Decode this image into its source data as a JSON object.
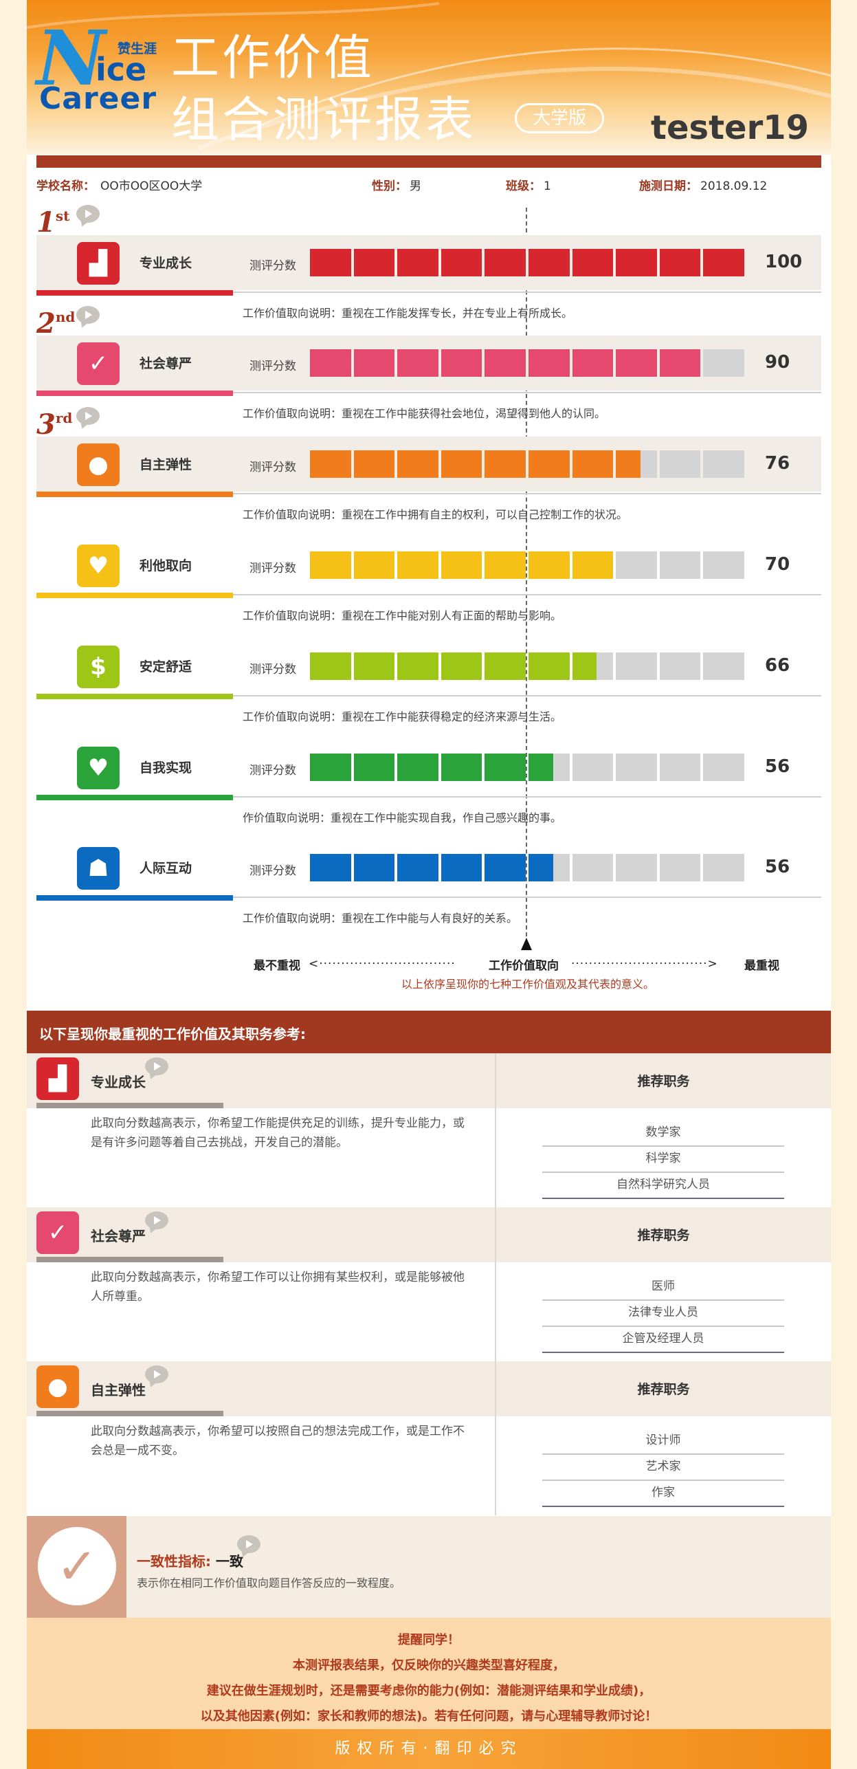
{
  "header": {
    "logo": {
      "brand_zh": "赞生涯",
      "n": "N",
      "ice": "ice",
      "career": "Career"
    },
    "title_line1": "工作价值",
    "title_line2": "组合测评报表",
    "edition": "大学版",
    "username": "tester19"
  },
  "info": {
    "school_label": "学校名称：",
    "school": "OO市OO区OO大学",
    "gender_label": "性别：",
    "gender": "男",
    "class_label": "班级：",
    "class": "1",
    "date_label": "施测日期：",
    "date": "2018.09.12"
  },
  "ranks": [
    {
      "num": "1",
      "sup": "st"
    },
    {
      "num": "2",
      "sup": "nd"
    },
    {
      "num": "3",
      "sup": "rd"
    }
  ],
  "score_label": "测评分数",
  "values": [
    {
      "name": "专业成长",
      "score": 100,
      "icon": "chart-up-icon",
      "glyph": "▟",
      "color": "#d8262f",
      "band": true,
      "desc": "工作价值取向说明：重视在工作能发挥专长，并在专业上有所成长。"
    },
    {
      "name": "社会尊严",
      "score": 90,
      "icon": "check-icon",
      "glyph": "✓",
      "color": "#e54a6e",
      "band": true,
      "desc": "工作价值取向说明：重视在工作中能获得社会地位，渴望得到他人的认同。"
    },
    {
      "name": "自主弹性",
      "score": 76,
      "icon": "lightbulb-icon",
      "glyph": "●",
      "color": "#f07c1c",
      "band": true,
      "desc": "工作价值取向说明：重视在工作中拥有自主的权利，可以自己控制工作的状况。"
    },
    {
      "name": "利他取向",
      "score": 70,
      "icon": "hands-heart-icon",
      "glyph": "♥",
      "color": "#f5c116",
      "band": false,
      "desc": "工作价值取向说明：重视在工作中能对别人有正面的帮助与影响。"
    },
    {
      "name": "安定舒适",
      "score": 66,
      "icon": "dollar-icon",
      "glyph": "$",
      "color": "#9ec617",
      "band": false,
      "desc": "工作价值取向说明：重视在工作中能获得稳定的经济来源与生活。"
    },
    {
      "name": "自我实现",
      "score": 56,
      "icon": "heart-icon",
      "glyph": "♥",
      "color": "#2aa43a",
      "band": false,
      "desc": "作价值取向说明：重视在工作中能实现自我，作自己感兴趣的事。"
    },
    {
      "name": "人际互动",
      "score": 56,
      "icon": "people-icon",
      "glyph": "☗",
      "color": "#0a6bc0",
      "band": false,
      "desc": "工作价值取向说明：重视在工作中能与人有良好的关系。"
    }
  ],
  "legend": {
    "left": "最不重视",
    "center": "工作价值取向",
    "right": "最重视",
    "note": "以上依序呈现你的七种工作价值观及其代表的意义。"
  },
  "section2": {
    "title": "以下呈现你最重视的工作价值及其职务参考:",
    "job_title": "推荐职务",
    "blocks": [
      {
        "name": "专业成长",
        "icon": "chart-up-icon",
        "glyph": "▟",
        "color": "#d8262f",
        "desc": "此取向分数越高表示，你希望工作能提供充足的训练，提升专业能力，或是有许多问题等着自己去挑战，开发自己的潜能。",
        "jobs": [
          "数学家",
          "科学家",
          "自然科学研究人员"
        ]
      },
      {
        "name": "社会尊严",
        "icon": "check-icon",
        "glyph": "✓",
        "color": "#e54a6e",
        "desc": "此取向分数越高表示，你希望工作可以让你拥有某些权利，或是能够被他人所尊重。",
        "jobs": [
          "医师",
          "法律专业人员",
          "企管及经理人员"
        ]
      },
      {
        "name": "自主弹性",
        "icon": "lightbulb-icon",
        "glyph": "●",
        "color": "#f07c1c",
        "desc": "此取向分数越高表示，你希望可以按照自己的想法完成工作，或是工作不会总是一成不变。",
        "jobs": [
          "设计师",
          "艺术家",
          "作家"
        ]
      }
    ]
  },
  "consistency": {
    "label": "一致性指标:",
    "value": "一致",
    "desc": "表示你在相同工作价值取向题目作答反应的一致程度。"
  },
  "reminder": {
    "line1": "提醒同学！",
    "line2": "本测评报表结果，仅反映你的兴趣类型喜好程度，",
    "line3": "建议在做生涯规划时，还是需要考虑你的能力(例如：潜能测评结果和学业成绩)，",
    "line4": "以及其他因素(例如：家长和教师的想法)。若有任何问题，请与心理辅导教师讨论！"
  },
  "footer": "版权所有·翻印必究"
}
